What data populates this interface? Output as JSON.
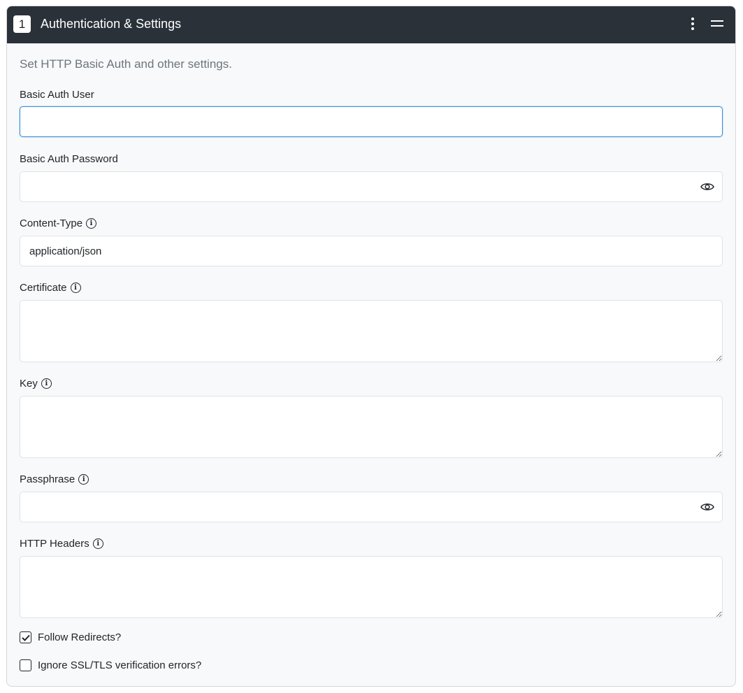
{
  "header": {
    "step": "1",
    "title": "Authentication & Settings"
  },
  "description": "Set HTTP Basic Auth and other settings.",
  "fields": {
    "user": {
      "label": "Basic Auth User",
      "value": ""
    },
    "password": {
      "label": "Basic Auth Password",
      "value": ""
    },
    "content_type": {
      "label": "Content-Type",
      "value": "application/json"
    },
    "certificate": {
      "label": "Certificate",
      "value": ""
    },
    "key": {
      "label": "Key",
      "value": ""
    },
    "passphrase": {
      "label": "Passphrase",
      "value": ""
    },
    "headers": {
      "label": "HTTP Headers",
      "value": ""
    }
  },
  "checkboxes": {
    "follow": {
      "label": "Follow Redirects?",
      "checked": true
    },
    "ignore_ssl": {
      "label": "Ignore SSL/TLS verification errors?",
      "checked": false
    }
  },
  "info_glyph": "i"
}
